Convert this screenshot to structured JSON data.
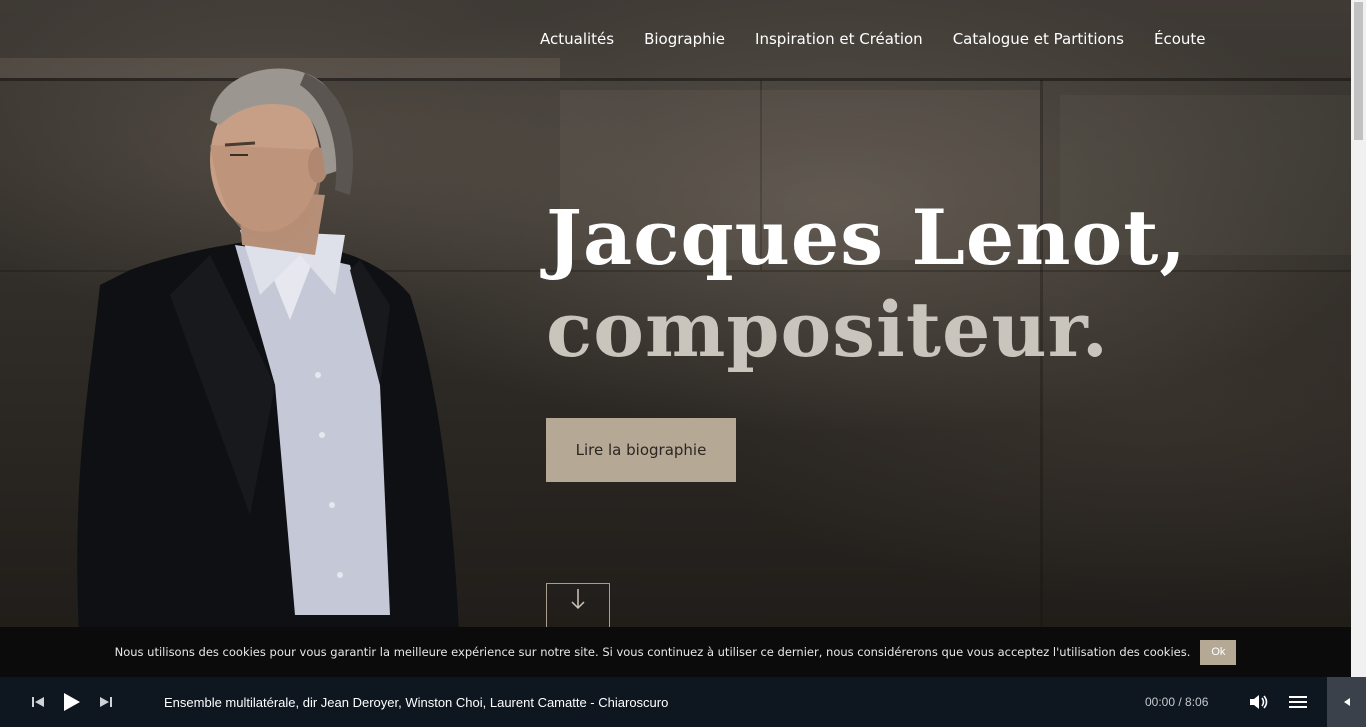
{
  "nav": {
    "items": [
      {
        "label": "Actualités"
      },
      {
        "label": "Biographie"
      },
      {
        "label": "Inspiration et Création"
      },
      {
        "label": "Catalogue et Partitions"
      },
      {
        "label": "Écoute"
      }
    ]
  },
  "hero": {
    "title_line1": "Jacques Lenot,",
    "title_line2": "compositeur.",
    "cta_label": "Lire la biographie",
    "scroll_icon": "arrow-down-icon"
  },
  "cookie": {
    "text": "Nous utilisons des cookies pour vous garantir la meilleure expérience sur notre site. Si vous continuez à utiliser ce dernier, nous considérerons que vous acceptez l'utilisation des cookies.",
    "ok_label": "Ok"
  },
  "player": {
    "track": "Ensemble multilatérale, dir Jean Deroyer, Winston Choi, Laurent Camatte - Chiaroscuro",
    "time": "00:00 / 8:06",
    "icons": [
      "previous-icon",
      "play-icon",
      "next-icon",
      "volume-icon",
      "playlist-icon",
      "collapse-icon"
    ]
  },
  "colors": {
    "accent": "#b5a895",
    "player_bg": "#0e1620",
    "cookie_bg": "#0b0b0b"
  }
}
